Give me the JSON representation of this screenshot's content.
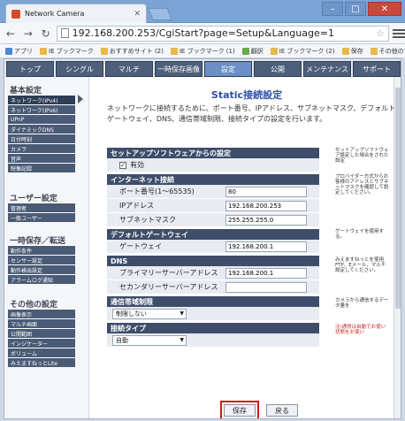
{
  "browser": {
    "tab_title": "Network Camera",
    "url": "192.168.200.253/CgiStart?page=Setup&Language=1",
    "bookmarks": [
      "アプリ",
      "IE ブックマーク",
      "おすすめサイト (2)",
      "IE ブックマーク (1)",
      "翻訳",
      "IE ブックマーク (2)",
      "保存"
    ],
    "bookmarks_right": "その他のブックマーク"
  },
  "nav": [
    "トップ",
    "シングル",
    "マルチ",
    "一時保存画像",
    "設定",
    "公開",
    "メンテナンス",
    "サポート"
  ],
  "sidebar": {
    "basic_head": "基本設定",
    "basic": [
      "ネットワーク(IPv4)",
      "ネットワーク(IPv6)",
      "UPnP",
      "ダイナミックDNS",
      "日付時刻",
      "カメラ",
      "音声",
      "映像記録"
    ],
    "user_head": "ユーザー設定",
    "user": [
      "管理者",
      "一般ユーザー"
    ],
    "temp_head": "一時保存／転送",
    "temp": [
      "動作条件",
      "センサー設定",
      "動作検出設定",
      "アラームログ通知"
    ],
    "other_head": "その他の設定",
    "other": [
      "画像表示",
      "マルチ画面",
      "公開範囲",
      "インジケーター",
      "ボリューム",
      "みえますねっとLite"
    ]
  },
  "content": {
    "title": "Static接続設定",
    "description": "ネットワークに接続するために、ポート番号、IPアドレス、サブネットマスク、デフォルトゲートウェイ、DNS、通信帯域制限、接続タイプの設定を行います。"
  },
  "form": {
    "sec_setup": "セットアップソフトウェアからの設定",
    "enabled_label": "有効",
    "sec_internet": "インターネット接続",
    "port_label": "ポート番号(1〜65535)",
    "port_value": "80",
    "ip_label": "IPアドレス",
    "ip_value": "192.168.200.253",
    "mask_label": "サブネットマスク",
    "mask_value": "255.255.255.0",
    "sec_gateway": "デフォルトゲートウェイ",
    "gateway_label": "ゲートウェイ",
    "gateway_value": "192.168.200.1",
    "sec_dns": "DNS",
    "dns1_label": "プライマリーサーバーアドレス",
    "dns1_value": "192.168.200.1",
    "dns2_label": "セカンダリーサーバーアドレス",
    "dns2_value": "",
    "sec_bandwidth": "通信帯域制限",
    "bandwidth_value": "制限しない",
    "sec_conn": "接続タイプ",
    "conn_value": "自動"
  },
  "help": {
    "h1": "セットアップソフトウェア設定した場合をされた設定",
    "h2": "プロバイダー方式からお客様のアドレスとサブネットマスクを確認して設定してください。",
    "h3": "ゲートウェイを使用する。",
    "h4": "みえますねっとを使用 FTP、Eメール、マルチ設定してください。",
    "h5": "カメラから通信するデータ量を",
    "h6": "注)通常は自動でお使い状態をお使い"
  },
  "buttons": {
    "save": "保存",
    "back": "戻る"
  }
}
